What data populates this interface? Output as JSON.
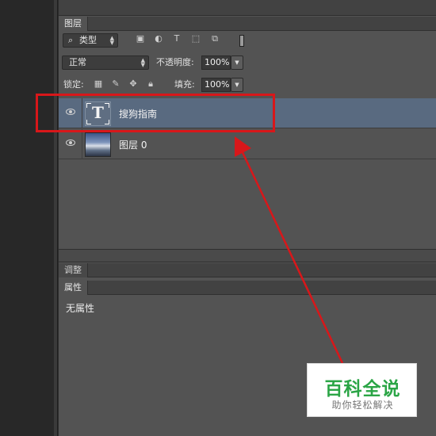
{
  "layers_panel": {
    "tab_label": "图层",
    "filter": {
      "kind_label": "类型",
      "icons": [
        "image-filter-icon",
        "adjustment-filter-icon",
        "text-filter-icon",
        "shape-filter-icon",
        "smart-object-filter-icon"
      ]
    },
    "blend_mode": "正常",
    "opacity_label": "不透明度:",
    "opacity_value": "100%",
    "lock_label": "锁定:",
    "lock_icons": [
      "lock-transparent-icon",
      "lock-image-icon",
      "lock-position-icon",
      "lock-all-icon"
    ],
    "fill_label": "填充:",
    "fill_value": "100%",
    "layers": [
      {
        "name": "搜狗指南",
        "type": "text",
        "selected": true,
        "thumb_glyph": "T"
      },
      {
        "name": "图层 0",
        "type": "image",
        "selected": false
      }
    ]
  },
  "adjustments_panel": {
    "tab_label": "调整"
  },
  "properties_panel": {
    "tab_label": "属性",
    "empty_message": "无属性"
  },
  "watermark": {
    "title": "百科全说",
    "subtitle": "助你轻松解决"
  },
  "colors": {
    "selection": "#596a80",
    "annotation": "#d8171a",
    "watermark_green": "#2ba546"
  }
}
